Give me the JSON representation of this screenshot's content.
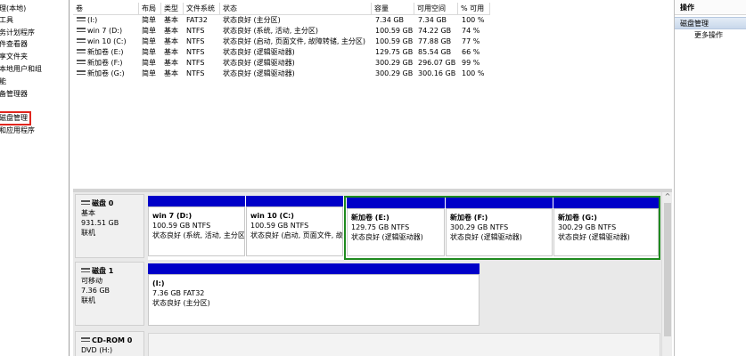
{
  "tree": {
    "items": [
      "理(本地)",
      "工具",
      "务计划程序",
      "件查看器",
      "享文件夹",
      "本地用户和组",
      "能",
      "备管理器",
      "",
      "磁盘管理",
      "和应用程序"
    ],
    "selected_label": "磁盘管理"
  },
  "volume_list": {
    "columns": [
      "卷",
      "布局",
      "类型",
      "文件系统",
      "状态",
      "容量",
      "可用空间",
      "% 可用"
    ],
    "rows": [
      [
        "(I:)",
        "简单",
        "基本",
        "FAT32",
        "状态良好 (主分区)",
        "7.34 GB",
        "7.34 GB",
        "100 %"
      ],
      [
        "win 7 (D:)",
        "简单",
        "基本",
        "NTFS",
        "状态良好 (系统, 活动, 主分区)",
        "100.59 GB",
        "74.22 GB",
        "74 %"
      ],
      [
        "win 10 (C:)",
        "简单",
        "基本",
        "NTFS",
        "状态良好 (启动, 页面文件, 故障转储, 主分区)",
        "100.59 GB",
        "77.88 GB",
        "77 %"
      ],
      [
        "新加卷 (E:)",
        "简单",
        "基本",
        "NTFS",
        "状态良好 (逻辑驱动器)",
        "129.75 GB",
        "85.54 GB",
        "66 %"
      ],
      [
        "新加卷 (F:)",
        "简单",
        "基本",
        "NTFS",
        "状态良好 (逻辑驱动器)",
        "300.29 GB",
        "296.07 GB",
        "99 %"
      ],
      [
        "新加卷 (G:)",
        "简单",
        "基本",
        "NTFS",
        "状态良好 (逻辑驱动器)",
        "300.29 GB",
        "300.16 GB",
        "100 %"
      ]
    ]
  },
  "disks": [
    {
      "title": "磁盘 0",
      "type": "基本",
      "size": "931.51 GB",
      "status": "联机",
      "partitions": [
        {
          "name": "win 7  (D:)",
          "size": "100.59 GB NTFS",
          "status": "状态良好 (系统, 活动, 主分区)"
        },
        {
          "name": "win 10  (C:)",
          "size": "100.59 GB NTFS",
          "status": "状态良好 (启动, 页面文件, 故"
        },
        {
          "name": "新加卷  (E:)",
          "size": "129.75 GB NTFS",
          "status": "状态良好 (逻辑驱动器)"
        },
        {
          "name": "新加卷  (F:)",
          "size": "300.29 GB NTFS",
          "status": "状态良好 (逻辑驱动器)"
        },
        {
          "name": "新加卷  (G:)",
          "size": "300.29 GB NTFS",
          "status": "状态良好 (逻辑驱动器)"
        }
      ]
    },
    {
      "title": "磁盘 1",
      "type": "可移动",
      "size": "7.36 GB",
      "status": "联机",
      "partitions": [
        {
          "name": "(I:)",
          "size": "7.36 GB FAT32",
          "status": "状态良好 (主分区)"
        }
      ]
    },
    {
      "title": "CD-ROM 0",
      "type": "DVD (H:)"
    }
  ],
  "actions": {
    "title": "操作",
    "section": "磁盘管理",
    "more": "更多操作"
  },
  "colors": {
    "primary_partition": "#0000c8",
    "extended_border": "#1f8a1f",
    "selection_outline": "#e0261e"
  }
}
